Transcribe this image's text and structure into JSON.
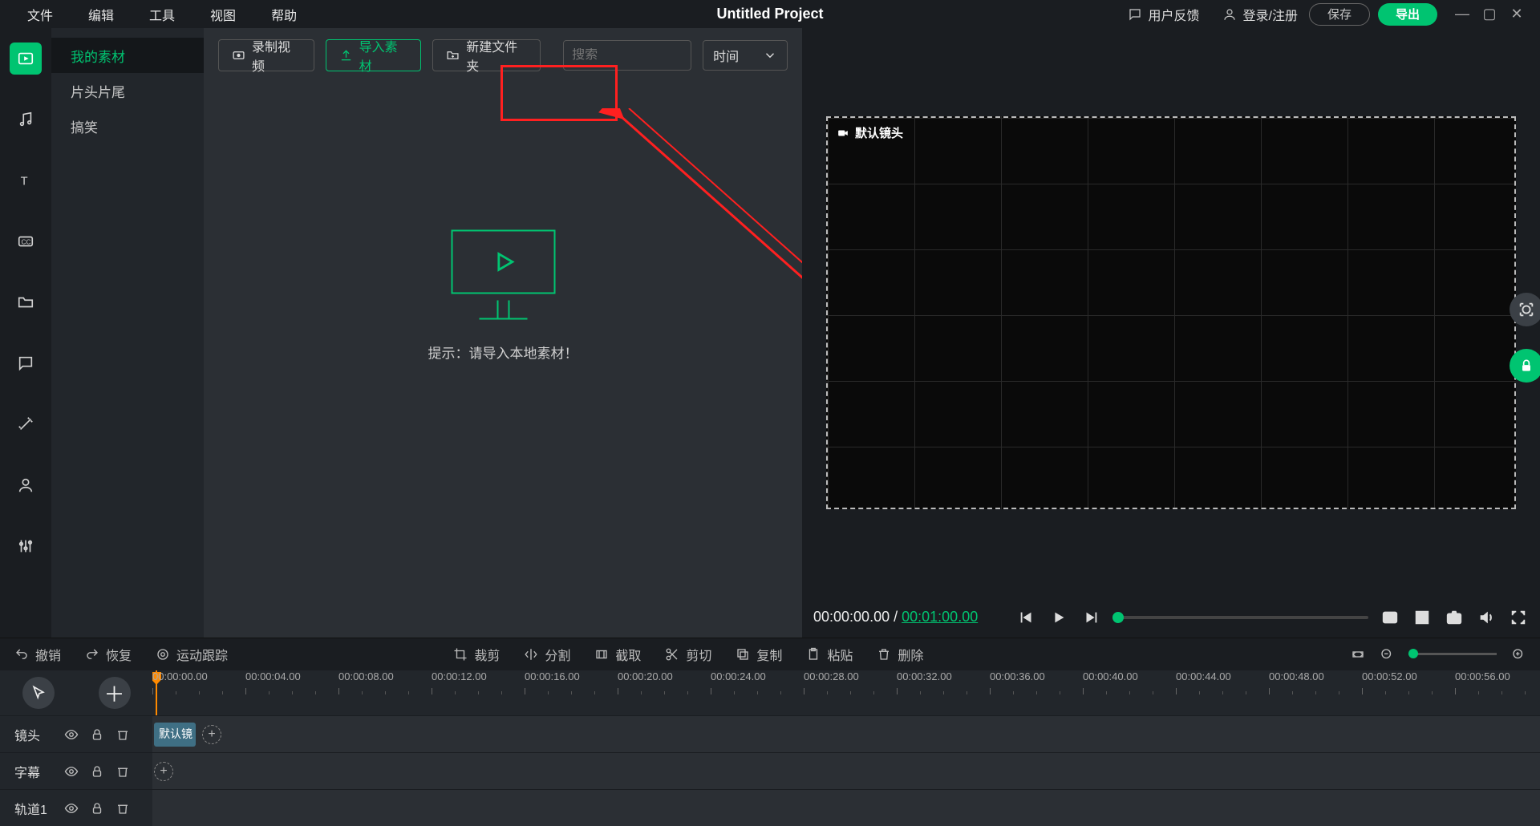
{
  "menu": {
    "file": "文件",
    "edit": "编辑",
    "tools": "工具",
    "view": "视图",
    "help": "帮助"
  },
  "project_title": "Untitled Project",
  "top_right": {
    "feedback": "用户反馈",
    "login": "登录/注册",
    "save": "保存",
    "export": "导出"
  },
  "library": {
    "items": [
      "我的素材",
      "片头片尾",
      "搞笑"
    ],
    "active_index": 0
  },
  "toolbar": {
    "record": "录制视频",
    "import": "导入素材",
    "new_folder": "新建文件夹",
    "search_placeholder": "搜索",
    "sort": "时间"
  },
  "empty_hint": "提示：请导入本地素材！",
  "preview": {
    "camera_label": "默认镜头",
    "current_tc": "00:00:00.00",
    "total_tc": "00:01:00.00"
  },
  "edit_tools": {
    "undo": "撤销",
    "redo": "恢复",
    "motion_track": "运动跟踪",
    "crop": "裁剪",
    "split": "分割",
    "trim": "截取",
    "cut": "剪切",
    "copy": "复制",
    "paste": "粘贴",
    "delete": "删除"
  },
  "timeline": {
    "ticks": [
      "00:00:00.00",
      "00:00:04.00",
      "00:00:08.00",
      "00:00:12.00",
      "00:00:16.00",
      "00:00:20.00",
      "00:00:24.00",
      "00:00:28.00",
      "00:00:32.00",
      "00:00:36.00",
      "00:00:40.00",
      "00:00:44.00",
      "00:00:48.00",
      "00:00:52.00",
      "00:00:56.00"
    ],
    "tick_spacing_px": 116,
    "rows": [
      {
        "label": "镜头",
        "clip": "默认镜"
      },
      {
        "label": "字幕",
        "clip": null
      },
      {
        "label": "轨道1",
        "clip": null
      }
    ]
  }
}
